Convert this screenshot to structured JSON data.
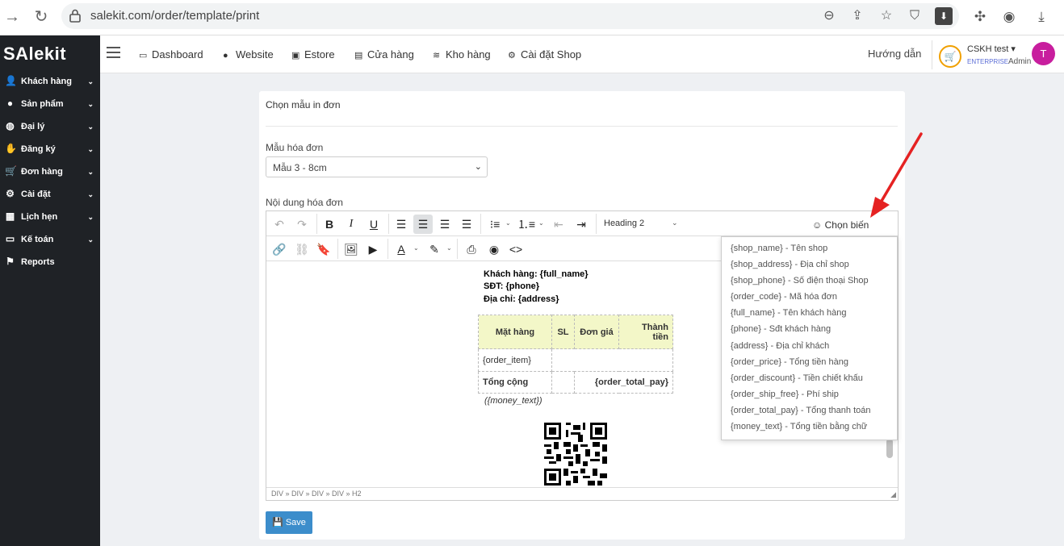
{
  "browser": {
    "url": "salekit.com/order/template/print"
  },
  "sidebar": {
    "logo": "SAlekit",
    "items": [
      {
        "label": "Khách hàng",
        "icon": "user-icon"
      },
      {
        "label": "Sản phẩm",
        "icon": "product-icon"
      },
      {
        "label": "Đại lý",
        "icon": "agent-icon"
      },
      {
        "label": "Đăng ký",
        "icon": "handshake-icon"
      },
      {
        "label": "Đơn hàng",
        "icon": "cart-icon"
      },
      {
        "label": "Cài đặt",
        "icon": "gear-icon"
      },
      {
        "label": "Lịch hẹn",
        "icon": "calendar-icon"
      },
      {
        "label": "Kế toán",
        "icon": "card-icon"
      },
      {
        "label": "Reports",
        "icon": "flag-icon"
      }
    ]
  },
  "topnav": {
    "items": [
      "Dashboard",
      "Website",
      "Estore",
      "Cửa hàng",
      "Kho hàng",
      "Cài đặt Shop"
    ],
    "help": "Hướng dẫn",
    "account_name": "CSKH test",
    "account_plan": "ENTERPRISE",
    "account_role": "Admin",
    "avatar_letter": "T"
  },
  "card": {
    "title": "Chọn mẫu in đơn",
    "template_label": "Mẫu hóa đơn",
    "template_value": "Mẫu 3 - 8cm",
    "content_label": "Nội dung hóa đơn",
    "save_label": "Save"
  },
  "editor": {
    "heading_value": "Heading 2",
    "variable_button": "Chọn biến",
    "statusbar": "DIV » DIV » DIV » DIV » H2"
  },
  "invoice": {
    "customer": "Khách hàng: {full_name}",
    "phone": "SĐT: {phone}",
    "address": "Địa chỉ: {address}",
    "col_item": "Mặt hàng",
    "col_qty": "SL",
    "col_price": "Đơn giá",
    "col_total_1": "Thành",
    "col_total_2": "tiền",
    "order_item": "{order_item}",
    "total_label": "Tổng cộng",
    "total_value": "{order_total_pay}",
    "money_text": "({money_text})"
  },
  "variables": [
    "{shop_name} - Tên shop",
    "{shop_address} - Địa chỉ shop",
    "{shop_phone} - Số điện thoại Shop",
    "{order_code} - Mã hóa đơn",
    "{full_name} - Tên khách hàng",
    "{phone} - Sđt khách hàng",
    "{address} - Địa chỉ khách",
    "{order_price} - Tổng tiền hàng",
    "{order_discount} - Tiền chiết khấu",
    "{order_ship_free} - Phí ship",
    "{order_total_pay} - Tổng thanh toán",
    "{money_text} - Tổng tiền bằng chữ"
  ],
  "colors": {
    "sidebar_bg": "#1f2226",
    "save_button": "#3c8dcb",
    "avatar": "#c81e9e",
    "arrow": "#e52222",
    "table_header": "#f3f7c8"
  }
}
